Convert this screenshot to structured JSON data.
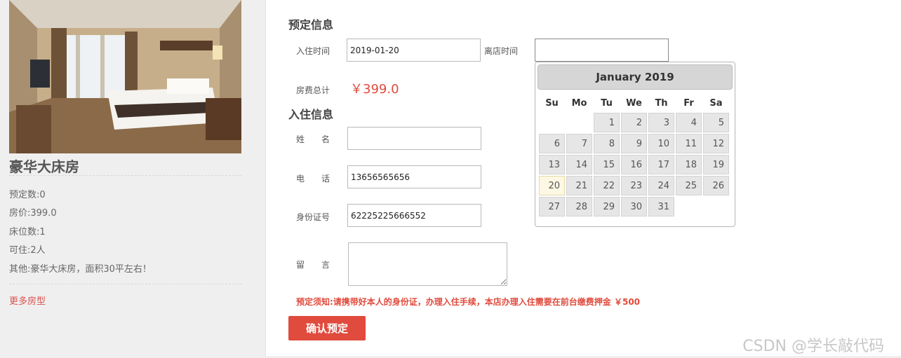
{
  "room": {
    "name": "豪华大床房",
    "details": [
      "预定数:0",
      "房价:399.0",
      "床位数:1",
      "可住:2人",
      "其他:豪华大床房，面积30平左右！"
    ],
    "more_link": "更多房型"
  },
  "booking": {
    "section_title": "预定信息",
    "checkin_label": "入住时间",
    "checkin_value": "2019-01-20",
    "checkout_label": "离店时间",
    "checkout_value": "",
    "total_label": "房费总计",
    "total_value": "￥399.0"
  },
  "guest": {
    "section_title": "入住信息",
    "name_label": "姓　　名",
    "name_value": "",
    "phone_label": "电　　话",
    "phone_value": "13656565656",
    "id_label": "身份证号",
    "id_value": "62225225666552",
    "message_label": "留　　言",
    "message_value": ""
  },
  "notice": "预定须知:请携带好本人的身份证，办理入住手续，本店办理入住需要在前台缴费押金 ￥500",
  "confirm_button": "确认预定",
  "calendar": {
    "month_title": "January 2019",
    "weekdays": [
      "Su",
      "Mo",
      "Tu",
      "We",
      "Th",
      "Fr",
      "Sa"
    ],
    "leading_blanks": 2,
    "days": 31,
    "today": 20
  },
  "watermark": "CSDN @学长敲代码",
  "colors": {
    "accent": "#e04b3d",
    "calendar_today": "#fcf8e3"
  }
}
